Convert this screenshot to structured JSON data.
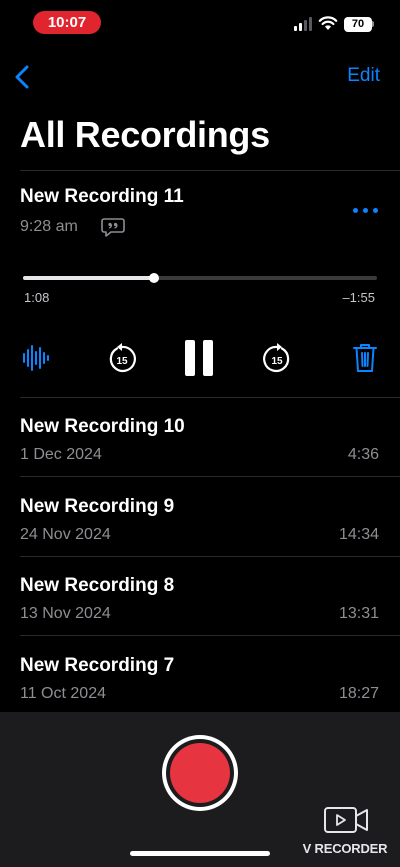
{
  "status_bar": {
    "time": "10:07",
    "battery": "70",
    "accent_color": "#e0252f"
  },
  "nav": {
    "back_icon": "chevron-left-icon",
    "edit_label": "Edit"
  },
  "page_title": "All Recordings",
  "expanded_recording": {
    "title": "New Recording 11",
    "time": "9:28 am",
    "transcript_icon": "transcript-quote-icon",
    "more_icon": "ellipsis-icon",
    "progress": 0.37,
    "elapsed": "1:08",
    "remaining": "–1:55",
    "controls": {
      "waveform_icon": "waveform-icon",
      "skip_back_icon": "skip-back-15-icon",
      "skip_back_label": "15",
      "pause_icon": "pause-icon",
      "skip_forward_icon": "skip-forward-15-icon",
      "skip_forward_label": "15",
      "delete_icon": "trash-icon"
    }
  },
  "recordings": [
    {
      "title": "New Recording 10",
      "date": "1 Dec 2024",
      "duration": "4:36"
    },
    {
      "title": "New Recording 9",
      "date": "24 Nov 2024",
      "duration": "14:34"
    },
    {
      "title": "New Recording 8",
      "date": "13 Nov 2024",
      "duration": "13:31"
    },
    {
      "title": "New Recording 7",
      "date": "11 Oct 2024",
      "duration": "18:27"
    }
  ],
  "record_button": {
    "icon": "record-icon",
    "color": "#e63440"
  },
  "watermark": {
    "label": "V RECORDER",
    "icon": "video-camera-icon"
  },
  "colors": {
    "accent": "#0a84ff",
    "background": "#000000",
    "secondary_text": "#8e8e93",
    "bottom_bar": "#1c1c1e"
  }
}
